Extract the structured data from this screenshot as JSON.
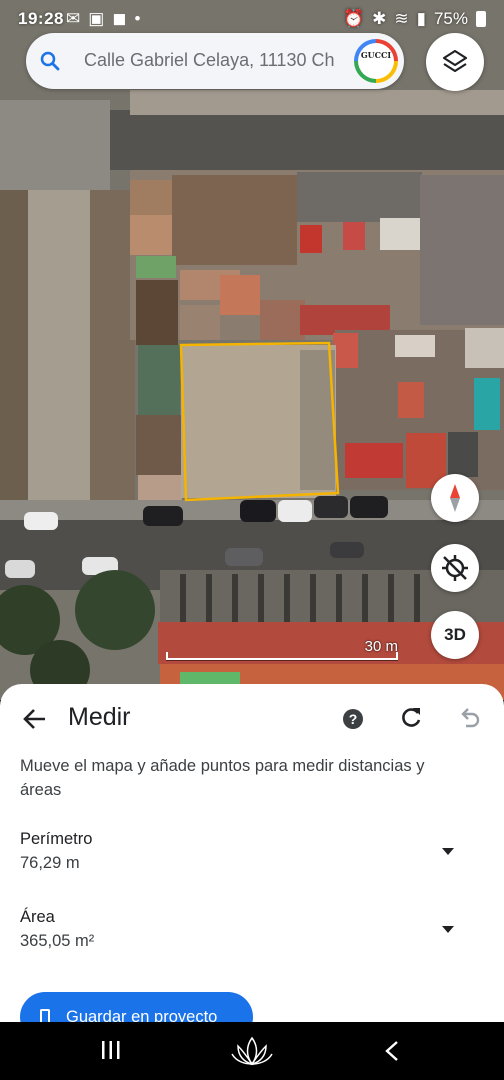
{
  "status": {
    "time": "19:28",
    "battery": "75%"
  },
  "search": {
    "value": "Calle Gabriel Celaya, 11130 Ch",
    "avatar_text": "GUCCI"
  },
  "map": {
    "scale_label": "30 m",
    "btn_3d": "3D",
    "outline_color": "#f5b400"
  },
  "sheet": {
    "title": "Medir",
    "description": "Mueve el mapa y añade puntos para medir distancias y áreas",
    "perimeter_label": "Perímetro",
    "perimeter_value": "76,29 m",
    "area_label": "Área",
    "area_value": "365,05 m²",
    "save_label": "Guardar en proyecto"
  },
  "colors": {
    "accent": "#1a73e8"
  }
}
